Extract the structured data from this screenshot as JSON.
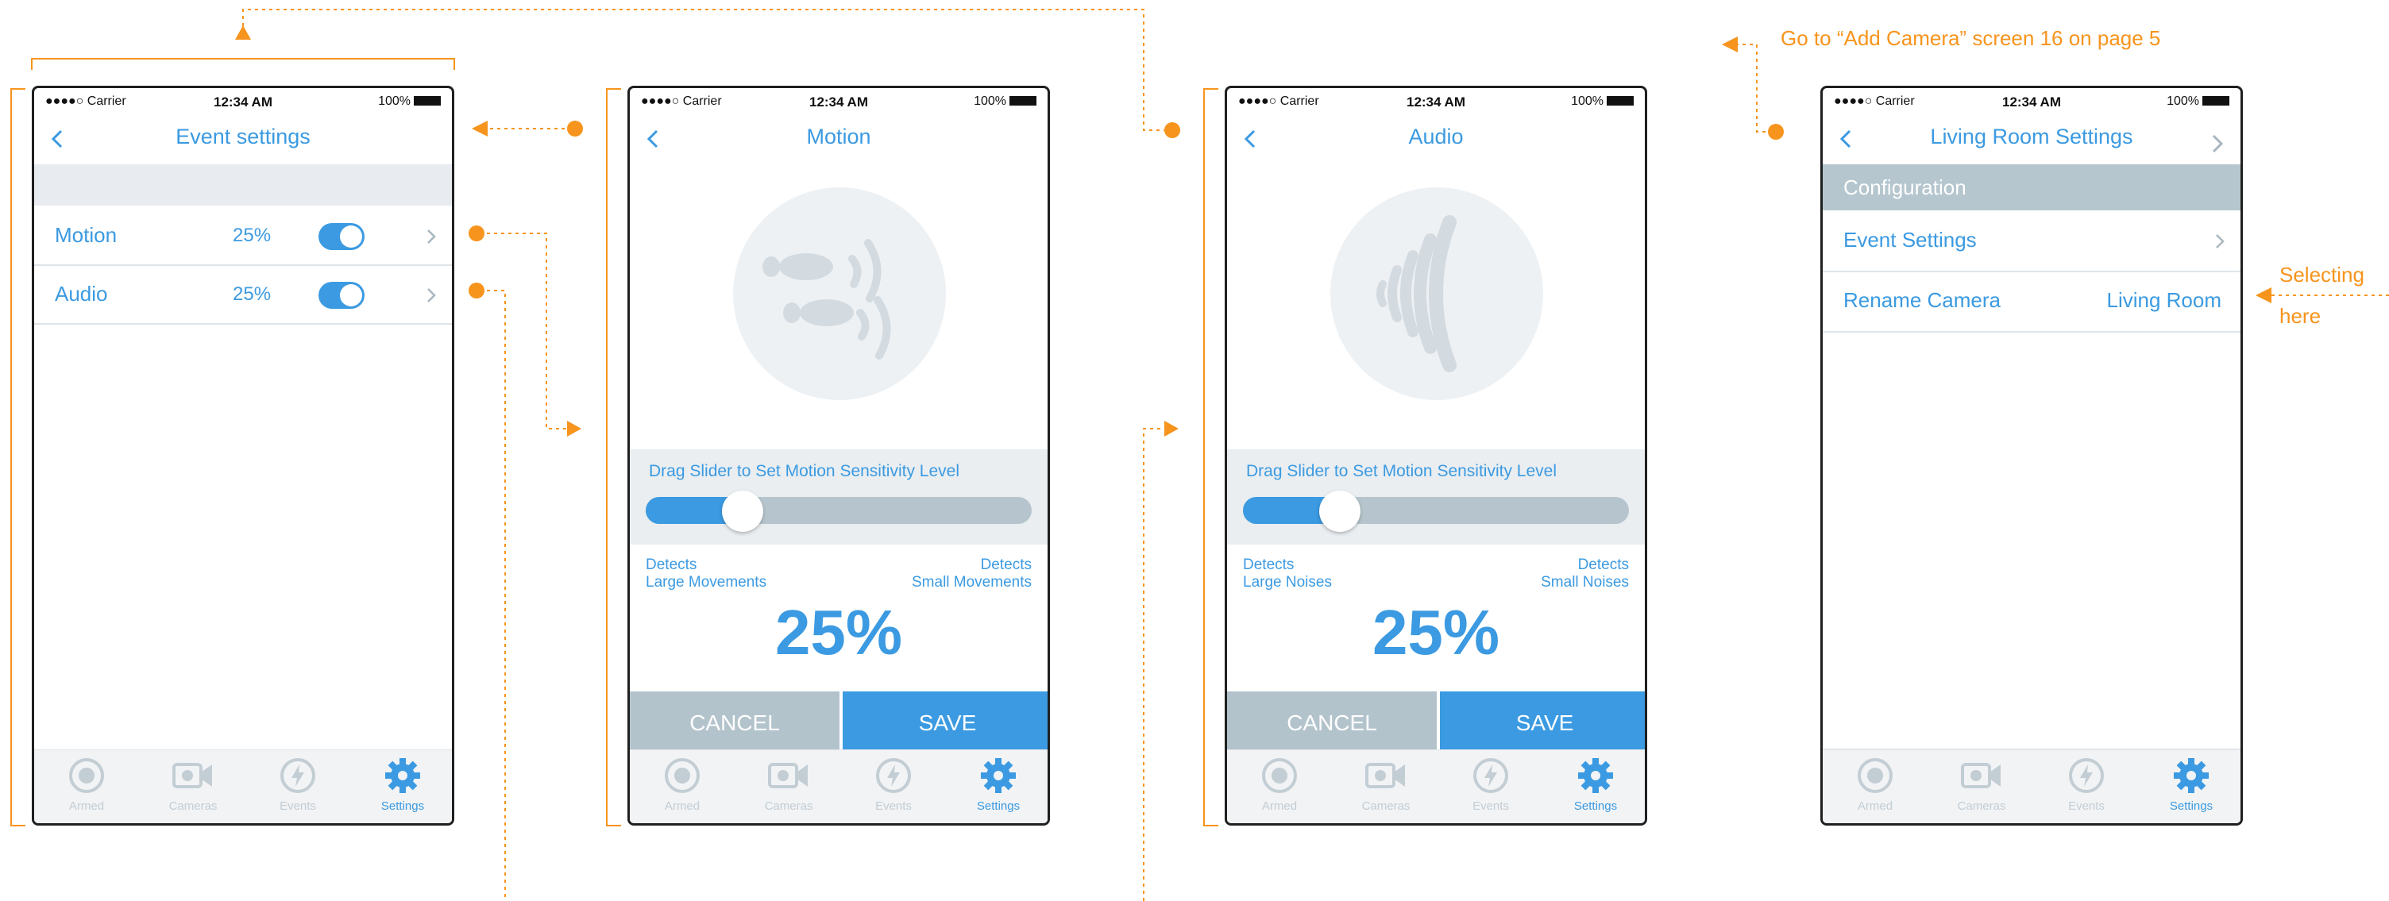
{
  "status_bar": {
    "carrier": "●●●●○ Carrier",
    "time": "12:34 AM",
    "battery": "100%"
  },
  "screen1": {
    "title": "Event settings",
    "rows": [
      {
        "label": "Motion",
        "percent": "25%"
      },
      {
        "label": "Audio",
        "percent": "25%"
      }
    ]
  },
  "screen2": {
    "title": "Motion",
    "slider_title": "Drag Slider to Set Motion Sensitivity Level",
    "left_top": "Detects",
    "left_bottom": "Large Movements",
    "right_top": "Detects",
    "right_bottom": "Small Movements",
    "value": "25%",
    "slider_level": 0.25,
    "cancel": "CANCEL",
    "save": "SAVE"
  },
  "screen3": {
    "title": "Audio",
    "slider_title": "Drag Slider to Set Motion Sensitivity Level",
    "left_top": "Detects",
    "left_bottom": "Large Noises",
    "right_top": "Detects",
    "right_bottom": "Small Noises",
    "value": "25%",
    "slider_level": 0.25,
    "cancel": "CANCEL",
    "save": "SAVE"
  },
  "screen4": {
    "title": "Living Room Settings",
    "section": "Configuration",
    "row1": "Event Settings",
    "row2_label": "Rename Camera",
    "row2_value": "Living Room"
  },
  "tabs": [
    "Armed",
    "Cameras",
    "Events",
    "Settings"
  ],
  "annotations": {
    "goto": "Go to “Add Camera” screen 16 on page 5",
    "select1": "Selecting",
    "select2": "here"
  },
  "colors": {
    "accent": "#3b9ae1",
    "annotation": "#f7941d",
    "section": "#b5c6ce",
    "cancel": "#b3c3cc"
  }
}
